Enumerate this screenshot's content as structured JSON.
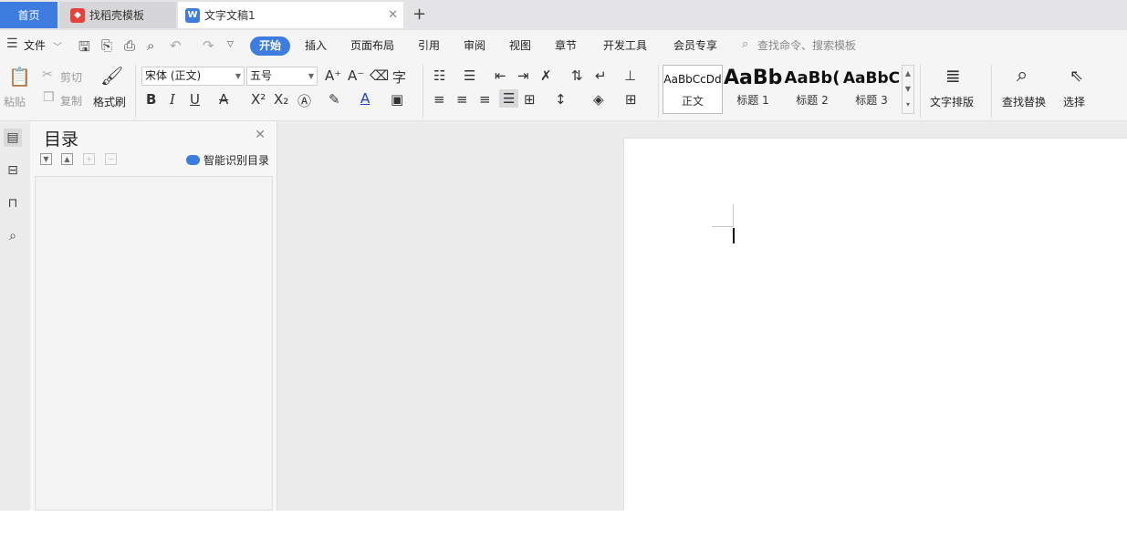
{
  "tabs": {
    "home": "首页",
    "daoke": "找稻壳模板",
    "doc": "文字文稿1",
    "add": "+",
    "close": "✕"
  },
  "menu": {
    "file": "文件",
    "items": [
      "开始",
      "插入",
      "页面布局",
      "引用",
      "审阅",
      "视图",
      "章节",
      "开发工具",
      "会员专享"
    ],
    "search_placeholder": "查找命令、搜索模板"
  },
  "ribbon": {
    "paste": "粘贴",
    "cut": "剪切",
    "copy": "复制",
    "format_painter": "格式刷",
    "font_name": "宋体 (正文)",
    "font_size": "五号",
    "styles": [
      {
        "sample": "AaBbCcDd",
        "name": "正文"
      },
      {
        "sample": "AaBb",
        "name": "标题 1"
      },
      {
        "sample": "AaBb(",
        "name": "标题 2"
      },
      {
        "sample": "AaBbC",
        "name": "标题 3"
      }
    ],
    "text_layout": "文字排版",
    "find_replace": "查找替换",
    "select": "选择"
  },
  "toc": {
    "title": "目录",
    "smart_detect": "智能识别目录"
  },
  "colors": {
    "accent": "#3d7de0",
    "daoke_logo": "#e8413c"
  }
}
